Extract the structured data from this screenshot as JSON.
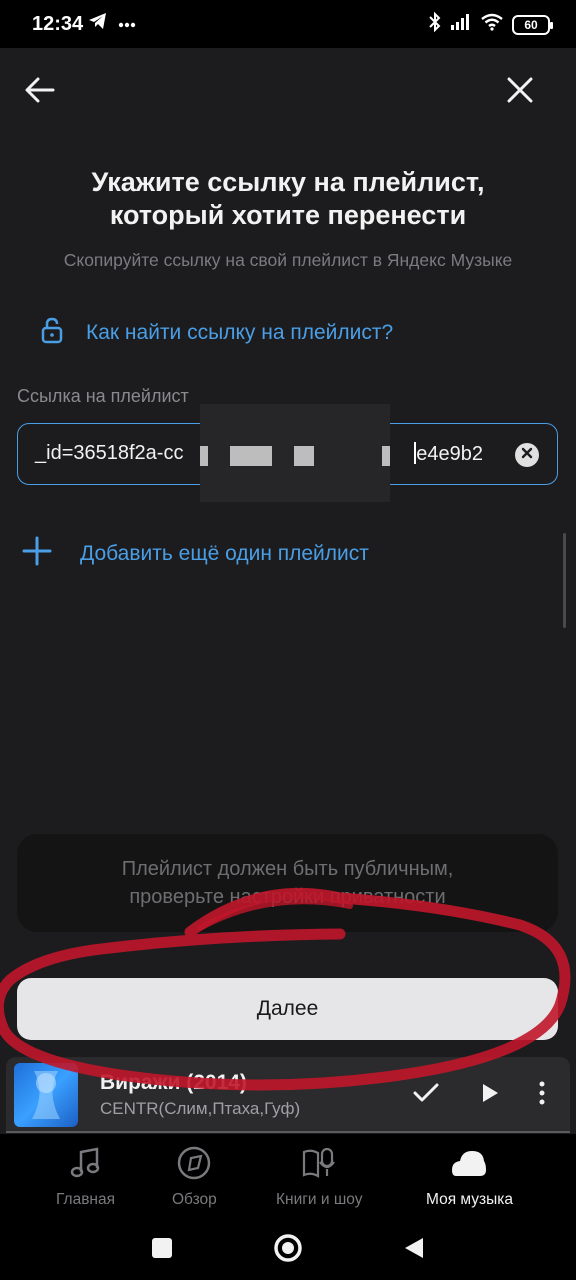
{
  "status_bar": {
    "time": "12:34",
    "left_icons": [
      "telegram-icon",
      "more-dots-icon"
    ],
    "right_icons": [
      "bluetooth-icon",
      "signal-icon",
      "wifi-icon"
    ],
    "battery": "60"
  },
  "header": {
    "back_icon": "arrow-left-icon",
    "close_icon": "close-icon",
    "title_line1": "Укажите ссылку на плейлист,",
    "title_line2": "который хотите перенести",
    "subtitle": "Скопируйте ссылку на свой плейлист в Яндекс Музыке"
  },
  "help_link": {
    "icon": "lock-icon",
    "label": "Как найти ссылку на плейлист?"
  },
  "playlist_field": {
    "label": "Ссылка на плейлист",
    "value_visible_start": "_id=36518f2a-cc",
    "value_visible_end": "e4e9b2",
    "clear_icon": "clear-icon"
  },
  "add_playlist": {
    "icon": "plus-icon",
    "label": "Добавить ещё один плейлист"
  },
  "notice": {
    "line1": "Плейлист должен быть публичным,",
    "line2": "проверьте настройки приватности"
  },
  "next_button": {
    "label": "Далее"
  },
  "mini_player": {
    "title": "Виражи (2014)",
    "artist": "CENTR(Слим,Птаха,Гуф)",
    "actions": [
      "check-icon",
      "play-icon",
      "more-vertical-icon"
    ]
  },
  "tabs": [
    {
      "label": "Главная",
      "icon": "music-note-icon",
      "active": false
    },
    {
      "label": "Обзор",
      "icon": "compass-icon",
      "active": false
    },
    {
      "label": "Книги и шоу",
      "icon": "book-mic-icon",
      "active": false
    },
    {
      "label": "Моя музыка",
      "icon": "my-music-icon",
      "active": true
    }
  ],
  "system_nav": [
    "recents-square-icon",
    "home-circle-icon",
    "back-triangle-icon"
  ],
  "colors": {
    "background": "#1c1c1e",
    "accent": "#4a9ee6",
    "annotation_red": "#c0162a"
  }
}
